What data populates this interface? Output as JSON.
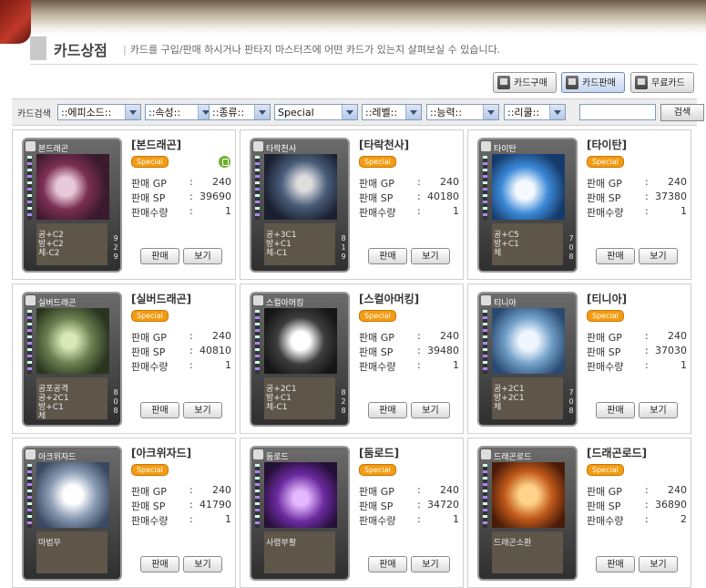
{
  "page": {
    "title": "카드상점",
    "description": "카드를 구입/판매 하시거나 판타지 마스터즈에 어떤 카드가 있는지 살펴보실 수 있습니다."
  },
  "tabs": [
    {
      "label": "카드구매",
      "active": false
    },
    {
      "label": "카드판매",
      "active": true
    },
    {
      "label": "무료카드",
      "active": false
    }
  ],
  "search": {
    "label": "카드검색",
    "filters": [
      {
        "name": "episode",
        "value": "::에피소드::"
      },
      {
        "name": "attribute",
        "value": "::속성::"
      },
      {
        "name": "type",
        "value": "::종류::"
      },
      {
        "name": "special",
        "value": "Special"
      },
      {
        "name": "level",
        "value": "::레벨::"
      },
      {
        "name": "ability",
        "value": "::능력::"
      },
      {
        "name": "rule",
        "value": "::리쿨::"
      }
    ],
    "input_value": "",
    "button_label": "검색"
  },
  "labels": {
    "gp": "판매 GP",
    "sp": "판매 SP",
    "qty": "판매수량",
    "colon": ":",
    "sell": "판매",
    "view": "보기",
    "badge": "Special"
  },
  "cards": [
    {
      "name": "[본드래곤]",
      "card_title": "본드래곤",
      "gp": "240",
      "sp": "39690",
      "qty": "1",
      "stats": "공+C2\n방+C2\n체-C2",
      "nums": "929",
      "locked": true
    },
    {
      "name": "[타락천사]",
      "card_title": "타락천사",
      "gp": "240",
      "sp": "40180",
      "qty": "1",
      "stats": "공+3C1\n방+C1\n체-C1",
      "nums": "819",
      "locked": false
    },
    {
      "name": "[타이탄]",
      "card_title": "타이탄",
      "gp": "240",
      "sp": "37380",
      "qty": "1",
      "stats": "공+C5\n방+C1\n체",
      "nums": "708",
      "locked": false
    },
    {
      "name": "[실버드래곤]",
      "card_title": "실버드래곤",
      "gp": "240",
      "sp": "40810",
      "qty": "1",
      "stats": "공포공격\n공+2C1\n방+C1\n체",
      "nums": "808",
      "locked": false
    },
    {
      "name": "[스컬아머킹]",
      "card_title": "스컬아머킹",
      "gp": "240",
      "sp": "39480",
      "qty": "1",
      "stats": "공+2C1\n방+C1\n체-C1",
      "nums": "828",
      "locked": false
    },
    {
      "name": "[티니아]",
      "card_title": "티니아",
      "gp": "240",
      "sp": "37030",
      "qty": "1",
      "stats": "공+2C1\n방+2C1\n체",
      "nums": "708",
      "locked": false
    },
    {
      "name": "[아크위자드]",
      "card_title": "아크위자드",
      "gp": "240",
      "sp": "41790",
      "qty": "1",
      "stats": "마법무",
      "nums": "",
      "locked": false
    },
    {
      "name": "[둠로드]",
      "card_title": "둠로드",
      "gp": "240",
      "sp": "34720",
      "qty": "1",
      "stats": "사령부활",
      "nums": "",
      "locked": false
    },
    {
      "name": "[드래곤로드]",
      "card_title": "드래곤로드",
      "gp": "240",
      "sp": "36890",
      "qty": "2",
      "stats": "드래곤소환",
      "nums": "",
      "locked": false
    }
  ]
}
